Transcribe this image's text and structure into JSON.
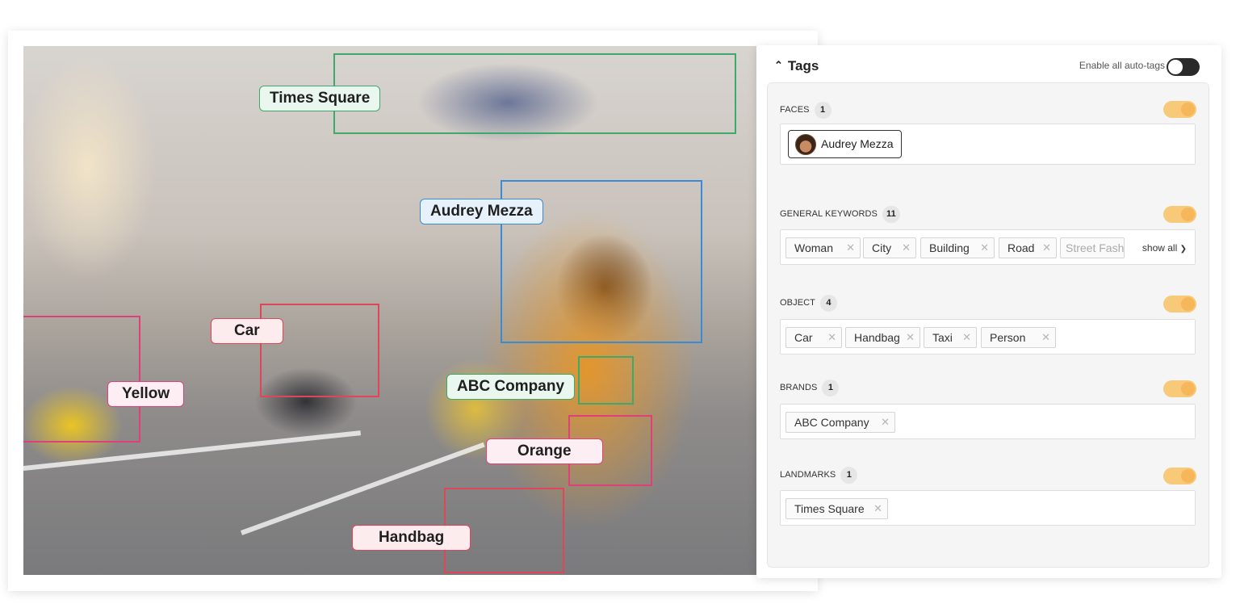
{
  "photo_labels": {
    "times_square": "Times Square",
    "audrey_mezza": "Audrey Mezza",
    "car": "Car",
    "yellow": "Yellow",
    "abc_company": "ABC Company",
    "orange": "Orange",
    "handbag": "Handbag"
  },
  "panel": {
    "title": "Tags",
    "enable_auto_tags": "Enable all auto-tags",
    "show_all": "show all"
  },
  "sections": {
    "faces": {
      "title": "FACES",
      "count": "1",
      "items": [
        "Audrey Mezza"
      ]
    },
    "general_keywords": {
      "title": "GENERAL KEYWORDS",
      "count": "11",
      "items": [
        "Woman",
        "City",
        "Building",
        "Road",
        "Street Fash"
      ]
    },
    "object": {
      "title": "OBJECT",
      "count": "4",
      "items": [
        "Car",
        "Handbag",
        "Taxi",
        "Person"
      ]
    },
    "brands": {
      "title": "BRANDS",
      "count": "1",
      "items": [
        "ABC Company"
      ]
    },
    "landmarks": {
      "title": "LANDMARKS",
      "count": "1",
      "items": [
        "Times Square"
      ]
    }
  },
  "colors": {
    "green": "#3daa6b",
    "blue": "#3b8ad4",
    "red": "#e0465a",
    "pink": "#e0407a",
    "toggle_on": "#f5b759"
  }
}
